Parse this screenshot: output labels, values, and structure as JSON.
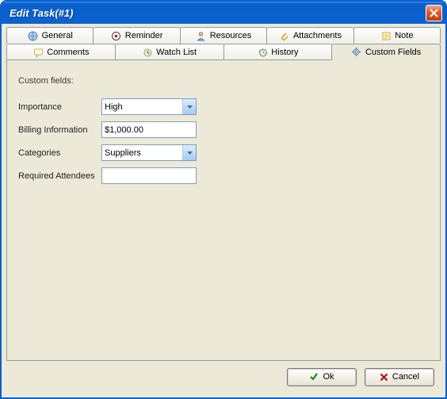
{
  "window": {
    "title": "Edit Task(#1)"
  },
  "tabs_row1": [
    {
      "label": "General",
      "icon": "globe-icon"
    },
    {
      "label": "Reminder",
      "icon": "bell-icon"
    },
    {
      "label": "Resources",
      "icon": "person-icon"
    },
    {
      "label": "Attachments",
      "icon": "clip-icon"
    },
    {
      "label": "Note",
      "icon": "note-icon"
    }
  ],
  "tabs_row2": [
    {
      "label": "Comments",
      "icon": "comment-icon",
      "active": false
    },
    {
      "label": "Watch List",
      "icon": "watch-icon",
      "active": false
    },
    {
      "label": "History",
      "icon": "history-icon",
      "active": false
    },
    {
      "label": "Custom Fields",
      "icon": "gear-icon",
      "active": true
    }
  ],
  "panel": {
    "heading": "Custom fields:",
    "fields": {
      "importance": {
        "label": "Importance",
        "value": "High",
        "type": "combo"
      },
      "billing": {
        "label": "Billing Information",
        "value": "$1,000.00",
        "type": "text"
      },
      "categories": {
        "label": "Categories",
        "value": "Suppliers",
        "type": "combo"
      },
      "required_attendees": {
        "label": "Required Attendees",
        "value": "",
        "type": "text"
      }
    }
  },
  "buttons": {
    "ok": "Ok",
    "cancel": "Cancel"
  }
}
